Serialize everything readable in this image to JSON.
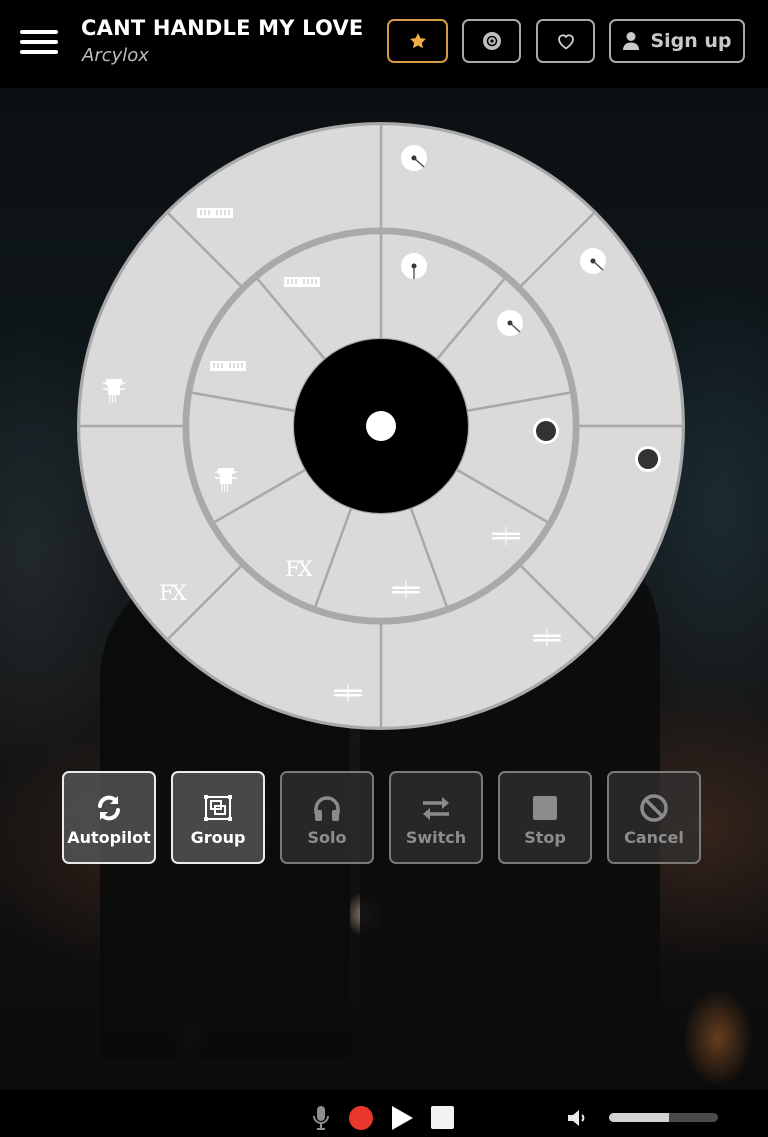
{
  "header": {
    "title": "CANT HANDLE MY LOVE",
    "artist": "Arcylox",
    "buttons": {
      "favorite_icon": "star-icon",
      "disc_icon": "disc-icon",
      "like_icon": "heart-icon",
      "signup_label": "Sign up",
      "signup_icon": "user-icon"
    },
    "favorite_color": "#f0ae45"
  },
  "wheel": {
    "center_dot": "play-center",
    "outer_ring": {
      "segments": [
        {
          "icon": "metronome-icon",
          "state": "needle-right"
        },
        {
          "icon": "metronome-icon",
          "state": "needle-right"
        },
        {
          "icon": "record-dot-icon",
          "state": "active"
        },
        {
          "icon": "cymbal-icon"
        },
        {
          "icon": "cymbal-icon"
        },
        {
          "icon": "fx-icon",
          "label": "FX"
        },
        {
          "icon": "synth-icon"
        },
        {
          "icon": "keyboard-icon"
        }
      ]
    },
    "inner_ring": {
      "segments": [
        {
          "icon": "metronome-icon",
          "state": "needle-down"
        },
        {
          "icon": "metronome-icon",
          "state": "needle-right"
        },
        {
          "icon": "record-dot-icon",
          "state": "active"
        },
        {
          "icon": "cymbal-icon"
        },
        {
          "icon": "cymbal-icon"
        },
        {
          "icon": "fx-icon",
          "label": "FX"
        },
        {
          "icon": "synth-icon"
        },
        {
          "icon": "keyboard-icon"
        },
        {
          "icon": "keyboard-icon"
        }
      ]
    },
    "fx_label": "FX"
  },
  "actions": [
    {
      "label": "Autopilot",
      "icon": "refresh-icon",
      "enabled": true
    },
    {
      "label": "Group",
      "icon": "group-icon",
      "enabled": true
    },
    {
      "label": "Solo",
      "icon": "headphones-icon",
      "enabled": false
    },
    {
      "label": "Switch",
      "icon": "switch-arrows-icon",
      "enabled": false
    },
    {
      "label": "Stop",
      "icon": "stop-icon",
      "enabled": false
    },
    {
      "label": "Cancel",
      "icon": "cancel-icon",
      "enabled": false
    }
  ],
  "player": {
    "mic_icon": "microphone-icon",
    "record_color": "#e8372c",
    "play_icon": "play-icon",
    "stop_icon": "stop-icon",
    "volume_icon": "volume-icon",
    "volume_percent": 55
  }
}
